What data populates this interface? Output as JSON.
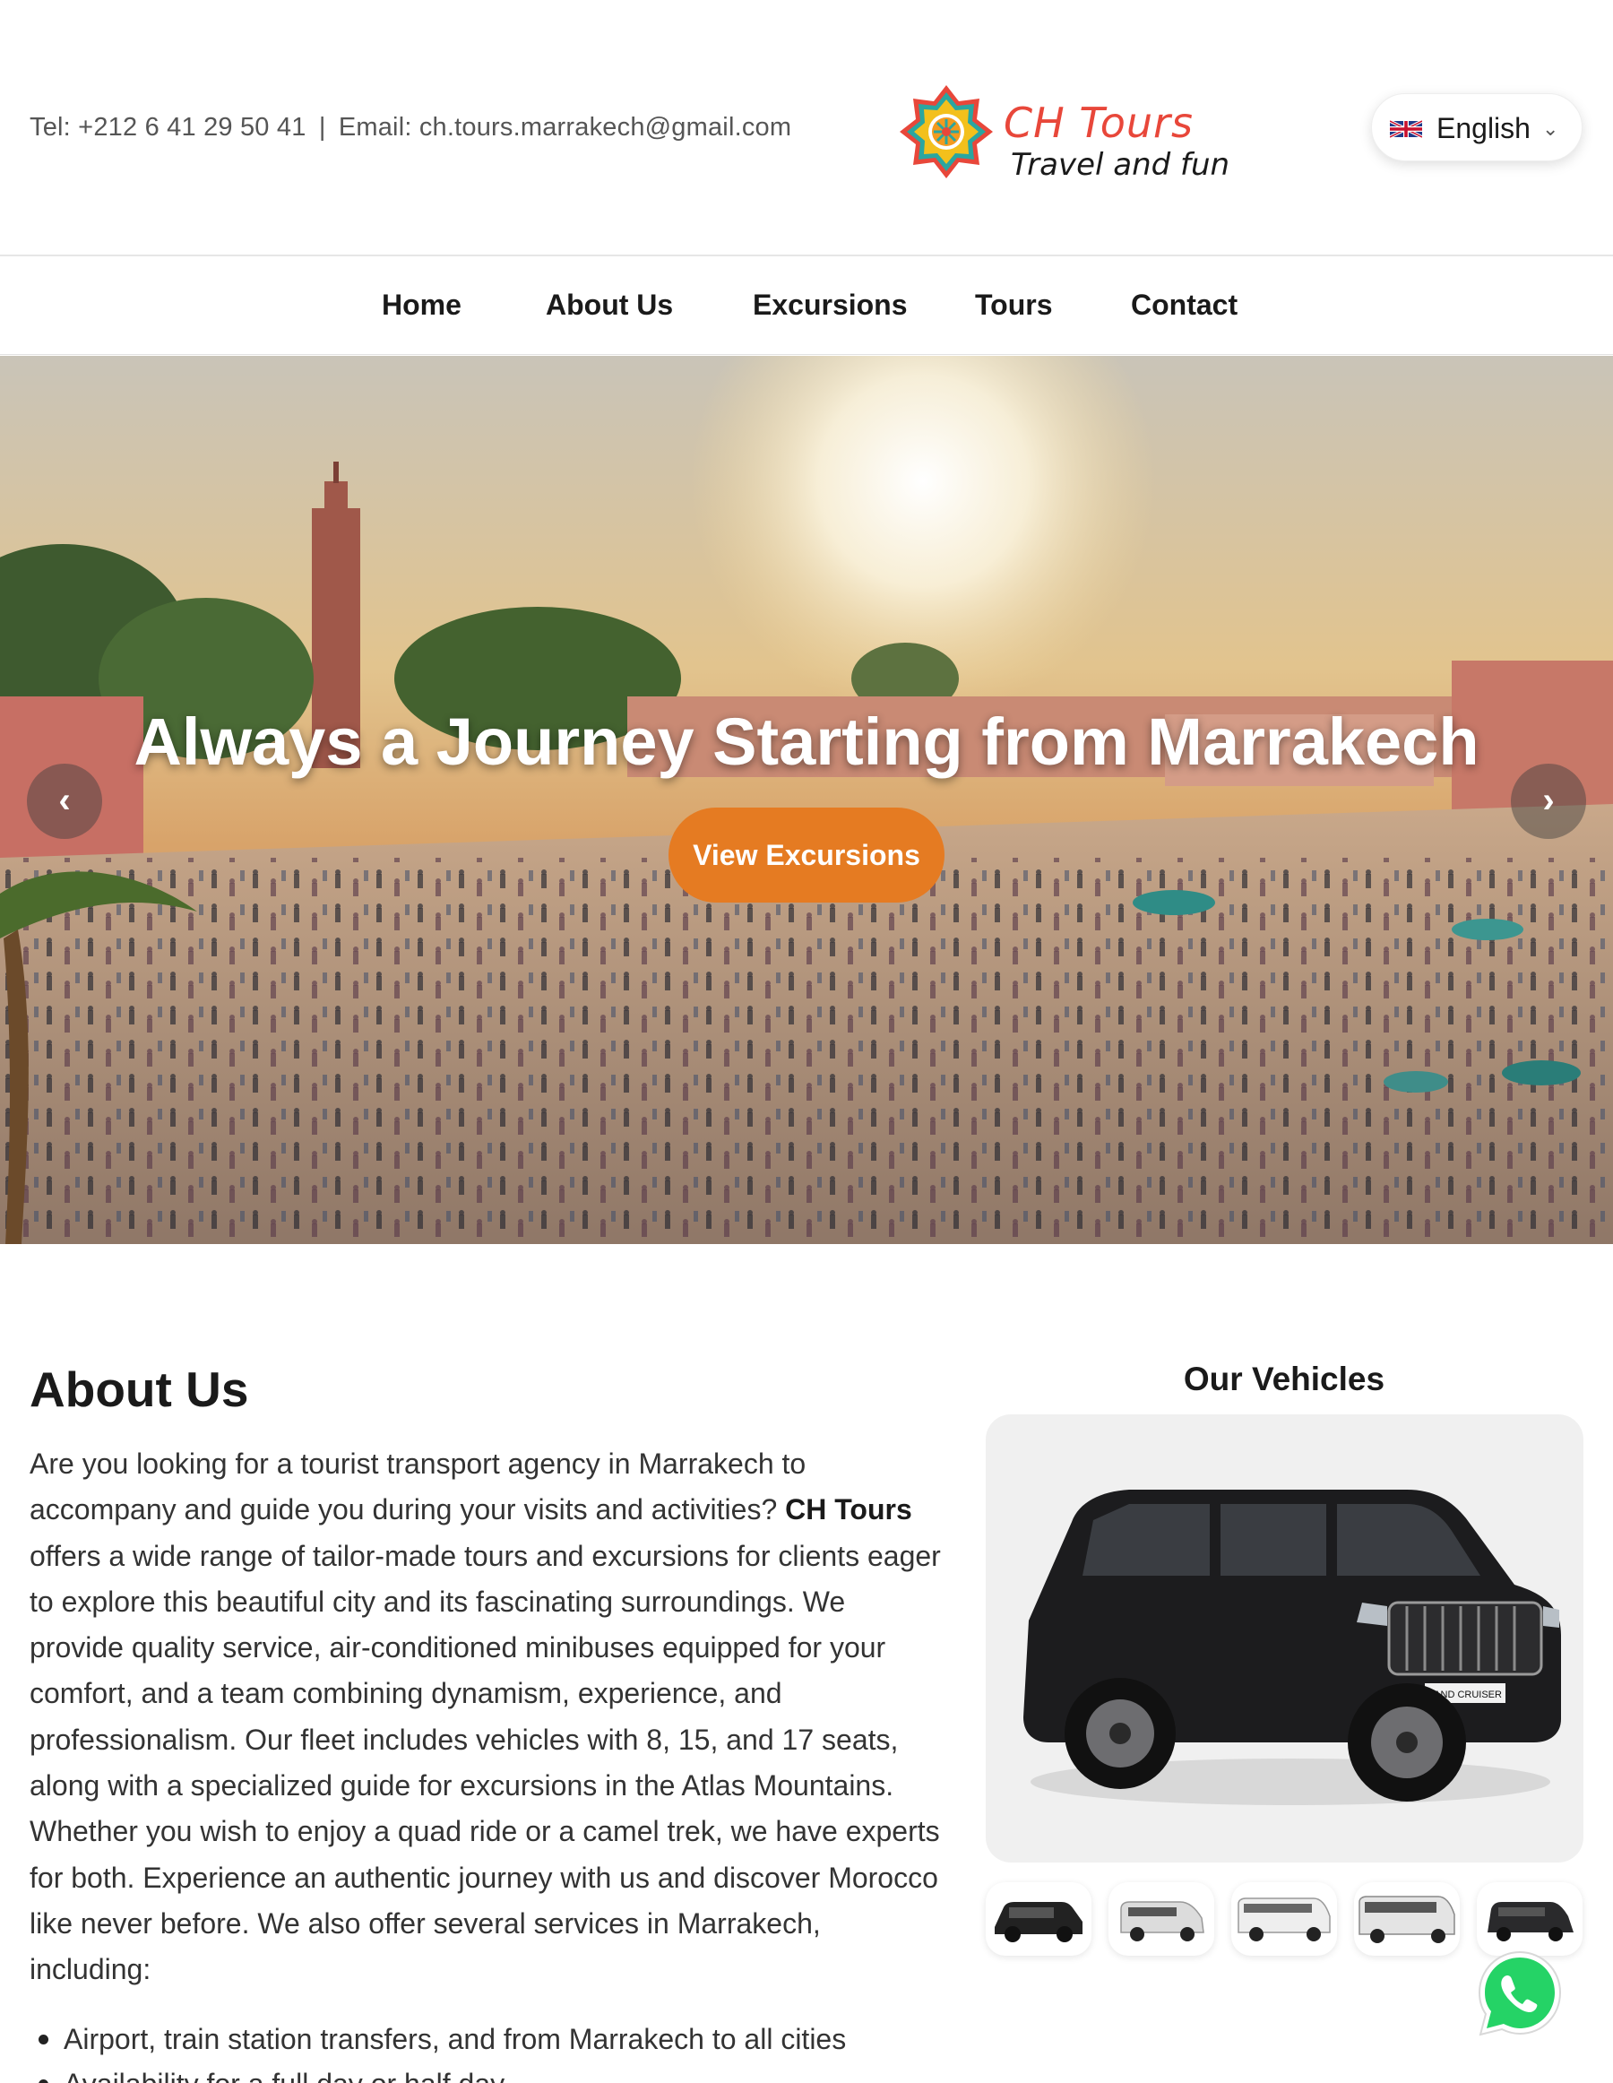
{
  "header": {
    "phone_label": "Tel: +212 6 41 29 50 41",
    "separator": "|",
    "email_label": "Email: ch.tours.marrakech@gmail.com",
    "logo_title": "CH Tours",
    "logo_subtitle": "Travel and fun",
    "language": {
      "selected": "English",
      "flag_icon": "uk-flag-icon",
      "chevron_icon": "chevron-down-icon"
    }
  },
  "nav": {
    "items": [
      {
        "label": "Home"
      },
      {
        "label": "About Us"
      },
      {
        "label": "Excursions"
      },
      {
        "label": "Tours"
      },
      {
        "label": "Contact"
      }
    ]
  },
  "hero": {
    "title": "Always a Journey Starting from Marrakech",
    "button_label": "View Excursions",
    "prev_label": "‹",
    "next_label": "›"
  },
  "about": {
    "heading": "About Us",
    "paragraph_before": "Are you looking for a tourist transport agency in Marrakech to accompany and guide you during your visits and activities? ",
    "brand": "CH Tours",
    "paragraph_after": " offers a wide range of tailor-made tours and excursions for clients eager to explore this beautiful city and its fascinating surroundings. We provide quality service, air-conditioned minibuses equipped for your comfort, and a team combining dynamism, experience, and professionalism. Our fleet includes vehicles with 8, 15, and 17 seats, along with a specialized guide for excursions in the Atlas Mountains. Whether you wish to enjoy a quad ride or a camel trek, we have experts for both. Experience an authentic journey with us and discover Morocco like never before. We also offer several services in Marrakech, including:",
    "services": [
      "Airport, train station transfers, and from Marrakech to all cities",
      "Availability for a full day or half day"
    ]
  },
  "vehicles": {
    "heading": "Our Vehicles",
    "main_plate": "LAND CRUISER"
  },
  "colors": {
    "accent": "#e57b22",
    "logo_red": "#e8473a",
    "whatsapp": "#25d366"
  }
}
